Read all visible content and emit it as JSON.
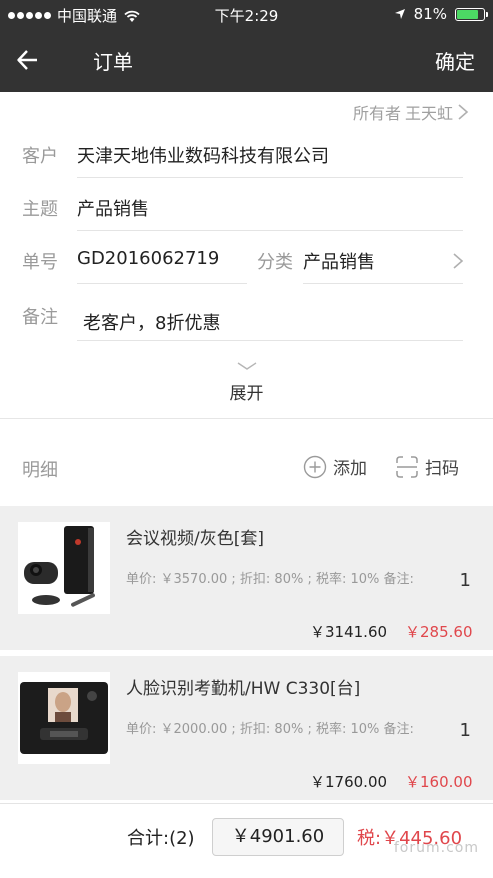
{
  "status_bar": {
    "carrier": "中国联通",
    "time": "下午2:29",
    "battery_pct": "81%",
    "battery_level": 0.81
  },
  "nav": {
    "title": "订单",
    "confirm": "确定"
  },
  "owner": {
    "label": "所有者",
    "name": "王天虹"
  },
  "form": {
    "customer_label": "客户",
    "customer_value": "天津天地伟业数码科技有限公司",
    "subject_label": "主题",
    "subject_value": "产品销售",
    "order_no_label": "单号",
    "order_no_value": "GD2016062719",
    "category_label": "分类",
    "category_value": "产品销售",
    "remark_label": "备注",
    "remark_value": "老客户，8折优惠",
    "expand": "展开"
  },
  "details": {
    "title": "明细",
    "add": "添加",
    "scan": "扫码"
  },
  "items": [
    {
      "name": "会议视频/灰色[套]",
      "meta": "单价: ￥3570.00 ; 折扣: 80% ; 税率: 10% 备注:",
      "qty": "1",
      "price": "￥3141.60",
      "tax": "￥285.60"
    },
    {
      "name": "人脸识别考勤机/HW C330[台]",
      "meta": "单价: ￥2000.00 ; 折扣: 80% ; 税率: 10% 备注:",
      "qty": "1",
      "price": "￥1760.00",
      "tax": "￥160.00"
    }
  ],
  "footer": {
    "total_label": "合计:(2)",
    "total_value": "￥4901.60",
    "tax_total": "税:￥445.60",
    "watermark": "forum.com"
  },
  "colors": {
    "header_bg": "#333333",
    "tax_red": "#e0474c",
    "item_bg": "#efefef"
  }
}
